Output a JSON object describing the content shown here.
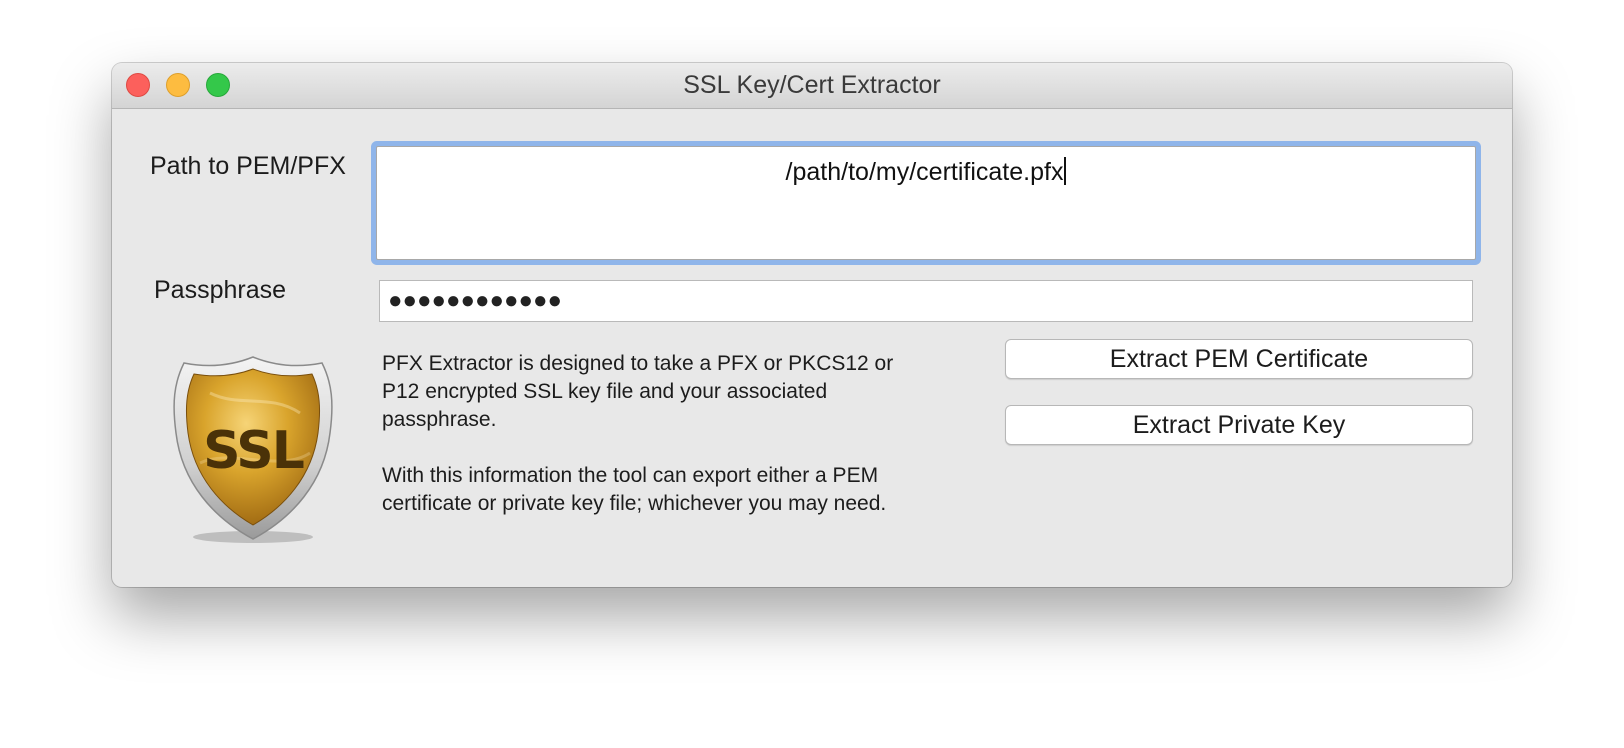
{
  "window": {
    "title": "SSL Key/Cert Extractor"
  },
  "form": {
    "path_label": "Path to PEM/PFX",
    "path_value": "/path/to/my/certificate.pfx",
    "passphrase_label": "Passphrase",
    "passphrase_value": "●●●●●●●●●●●●"
  },
  "logo": {
    "text": "SSL",
    "colors": {
      "shield_gold": "#d49a1c",
      "shield_rim": "#cfcfcf"
    }
  },
  "description": {
    "paragraph_1": "PFX Extractor is designed to take a PFX or PKCS12 or P12 encrypted SSL key file and your associated passphrase.",
    "paragraph_2": "With this information the tool can export either a PEM certificate or private key file; whichever you may need."
  },
  "actions": {
    "extract_pem_label": "Extract PEM Certificate",
    "extract_key_label": "Extract Private Key"
  },
  "colors": {
    "focus_ring": "#8fb5ea",
    "close": "#fc605c",
    "minimize": "#fdbc40",
    "zoom": "#34c84a"
  }
}
